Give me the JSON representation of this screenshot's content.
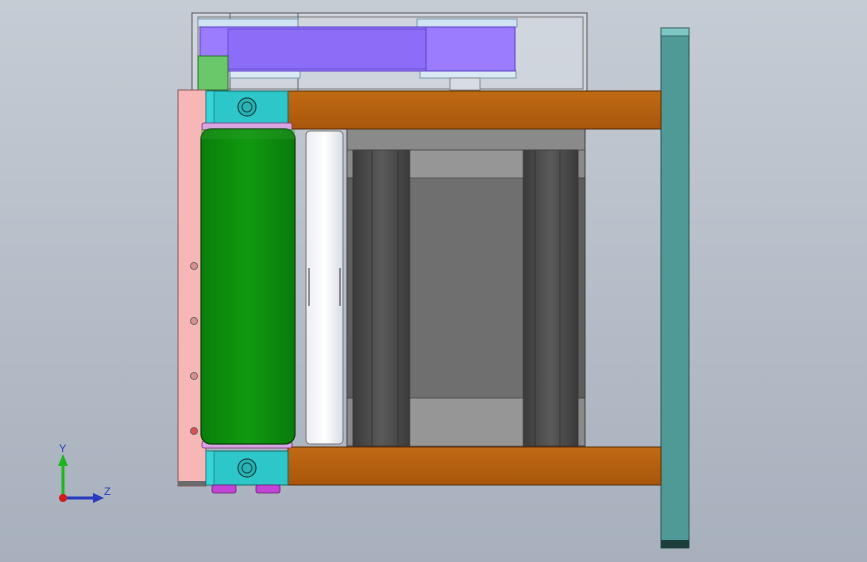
{
  "viewport": {
    "background": "#b9c0ca"
  },
  "model": {
    "parts": [
      {
        "name": "belt-guard-frame",
        "color": "#e6ebf1"
      },
      {
        "name": "timing-belt",
        "color": "#9b7cff"
      },
      {
        "name": "pulleys",
        "color": "#cfe3f2"
      },
      {
        "name": "sensor-block",
        "color": "#6ac86a"
      },
      {
        "name": "top-plate",
        "color": "#b5600f"
      },
      {
        "name": "bottom-plate",
        "color": "#b5600f"
      },
      {
        "name": "bearing-housings",
        "color": "#2ec7c9"
      },
      {
        "name": "drive-roller",
        "color": "#0a8f0a"
      },
      {
        "name": "idler-roller",
        "color": "#f4f6f8"
      },
      {
        "name": "side-plate",
        "color": "#f7b7b7"
      },
      {
        "name": "motor-body",
        "color": "#8a8a8a"
      },
      {
        "name": "mount-plate",
        "color": "#4f9a96"
      },
      {
        "name": "end-caps",
        "color": "#c244d6"
      }
    ]
  },
  "triad": {
    "y_label": "Y",
    "z_label": "Z",
    "y_color": "#1fb51f",
    "z_color": "#2a3bbf",
    "origin_color": "#d21a1a"
  }
}
